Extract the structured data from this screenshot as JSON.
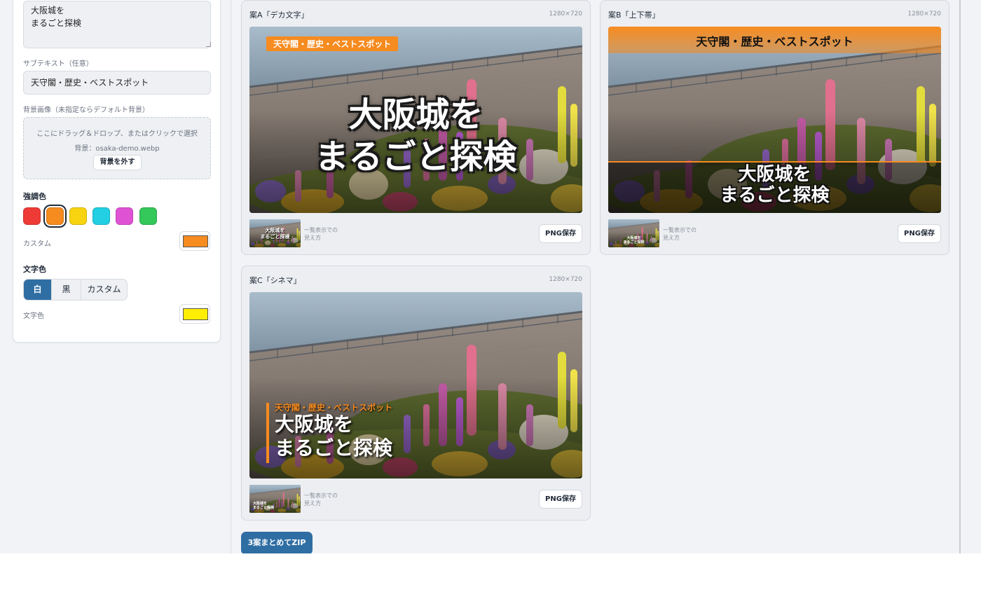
{
  "form": {
    "title_text": "大阪城を\nまるごと探検",
    "subtext_label": "サブテキスト（任意）",
    "subtext_value": "天守閣・歴史・ベストスポット",
    "bg_label": "背景画像（未指定ならデフォルト背景）",
    "dropzone_hint": "ここにドラッグ＆ドロップ、またはクリックで選択",
    "bg_file": "背景：osaka-demo.webp",
    "remove_bg_label": "背景を外す",
    "accent_label": "強調色",
    "accent_swatches": [
      "#ef3b36",
      "#f68b1f",
      "#f8d30f",
      "#22cfe3",
      "#e052d4",
      "#34c759"
    ],
    "accent_selected": "#f68b1f",
    "custom_label": "カスタム",
    "custom_accent": "#f68b1f",
    "textcolor_label": "文字色",
    "textcolor_options": [
      "白",
      "黒",
      "カスタム"
    ],
    "textcolor_selected": "白",
    "textcolor_custom_label": "文字色",
    "textcolor_custom": "#ffee00"
  },
  "cards": [
    {
      "title": "案A「デカ文字」",
      "size": "1280×720",
      "caption": "一覧表示での\n見え方",
      "png_label": "PNG保存",
      "overlay_sub": "天守閣・歴史・ベストスポット",
      "overlay_main": "大阪城を\nまるごと探検"
    },
    {
      "title": "案B「上下帯」",
      "size": "1280×720",
      "caption": "一覧表示での\n見え方",
      "png_label": "PNG保存",
      "overlay_sub": "天守閣・歴史・ベストスポット",
      "overlay_main": "大阪城を\nまるごと探検"
    },
    {
      "title": "案C「シネマ」",
      "size": "1280×720",
      "caption": "一覧表示での\n見え方",
      "png_label": "PNG保存",
      "overlay_sub": "天守閣・歴史・ベストスポット",
      "overlay_main": "大阪城を\nまるごと探検"
    }
  ],
  "zip_label": "3案まとめてZIP",
  "colors": {
    "primary": "#2f6ea3",
    "accent": "#f68b1f",
    "text_custom": "#ffee00"
  }
}
